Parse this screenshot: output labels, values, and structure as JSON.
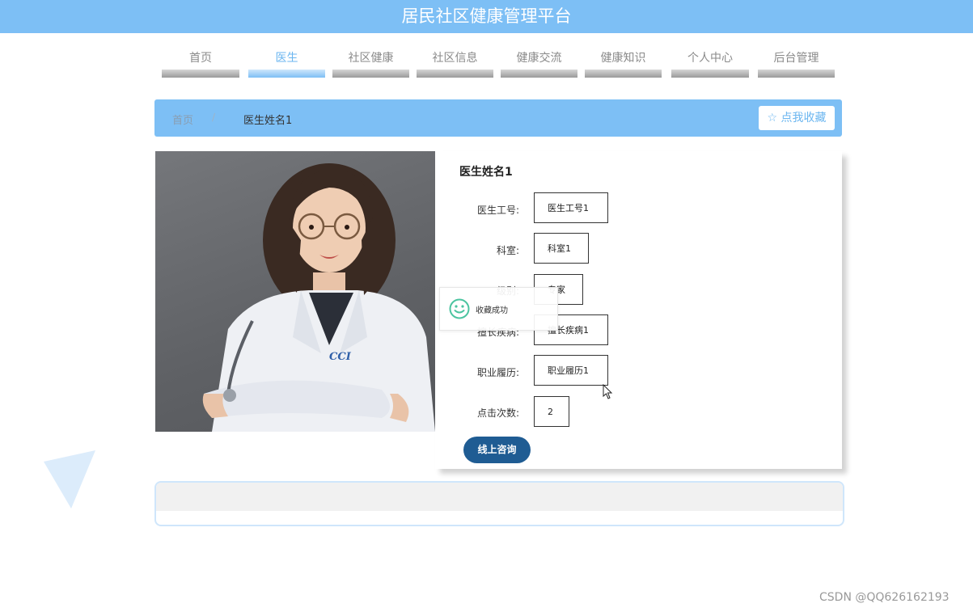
{
  "header": {
    "title": "居民社区健康管理平台"
  },
  "nav": {
    "items": [
      {
        "label": "首页"
      },
      {
        "label": "医生"
      },
      {
        "label": "社区健康"
      },
      {
        "label": "社区信息"
      },
      {
        "label": "健康交流"
      },
      {
        "label": "健康知识"
      },
      {
        "label": "个人中心"
      },
      {
        "label": "后台管理"
      }
    ]
  },
  "breadcrumb": {
    "home": "首页",
    "separator": "/",
    "current": "医生姓名1"
  },
  "favorite": {
    "label": "☆ 点我收藏"
  },
  "doctor": {
    "name": "医生姓名1",
    "fields": [
      {
        "label": "医生工号:",
        "value": "医生工号1"
      },
      {
        "label": "科室:",
        "value": "科室1"
      },
      {
        "label": "级别:",
        "value": "专家"
      },
      {
        "label": "擅长疾病:",
        "value": "擅长疾病1"
      },
      {
        "label": "职业履历:",
        "value": "职业履历1"
      },
      {
        "label": "点击次数:",
        "value": "2"
      }
    ],
    "consult_label": "线上咨询"
  },
  "toast": {
    "text": "收藏成功",
    "icon": "smile-icon"
  },
  "watermark": "CSDN @QQ626162193",
  "colors": {
    "primary": "#7dbff5",
    "accent_dark": "#1f5c93",
    "toast_icon": "#4cc4a0"
  }
}
